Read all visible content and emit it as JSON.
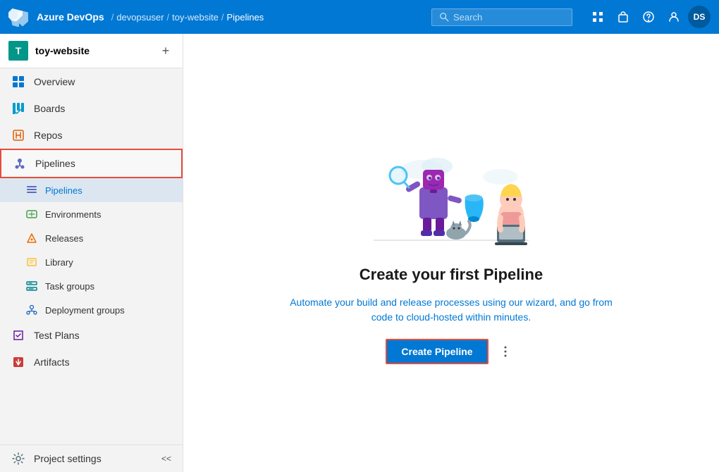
{
  "topnav": {
    "brand": "Azure DevOps",
    "breadcrumb": {
      "org": "devopsuser",
      "project": "toy-website",
      "current": "Pipelines"
    },
    "search_placeholder": "Search",
    "avatar_initials": "DS"
  },
  "sidebar": {
    "project_name": "toy-website",
    "project_icon_letter": "T",
    "items": [
      {
        "id": "overview",
        "label": "Overview",
        "icon": "overview"
      },
      {
        "id": "boards",
        "label": "Boards",
        "icon": "boards"
      },
      {
        "id": "repos",
        "label": "Repos",
        "icon": "repos"
      },
      {
        "id": "pipelines",
        "label": "Pipelines",
        "icon": "pipelines",
        "active": true,
        "highlighted": true
      }
    ],
    "sub_items": [
      {
        "id": "pipelines-sub",
        "label": "Pipelines",
        "icon": "pipelines-sub",
        "active": true
      },
      {
        "id": "environments",
        "label": "Environments",
        "icon": "environments"
      },
      {
        "id": "releases",
        "label": "Releases",
        "icon": "releases"
      },
      {
        "id": "library",
        "label": "Library",
        "icon": "library"
      },
      {
        "id": "task-groups",
        "label": "Task groups",
        "icon": "taskgroups"
      },
      {
        "id": "deployment-groups",
        "label": "Deployment groups",
        "icon": "deployment"
      }
    ],
    "bottom_items": [
      {
        "id": "test-plans",
        "label": "Test Plans",
        "icon": "testplans"
      },
      {
        "id": "artifacts",
        "label": "Artifacts",
        "icon": "artifacts"
      }
    ],
    "footer": {
      "label": "Project settings",
      "collapse_label": "<<"
    }
  },
  "main": {
    "title": "Create your first Pipeline",
    "description_line1": "Automate your build and release processes using our wizard, and go from",
    "description_line2": "code to cloud-hosted within minutes.",
    "create_btn_label": "Create Pipeline"
  }
}
